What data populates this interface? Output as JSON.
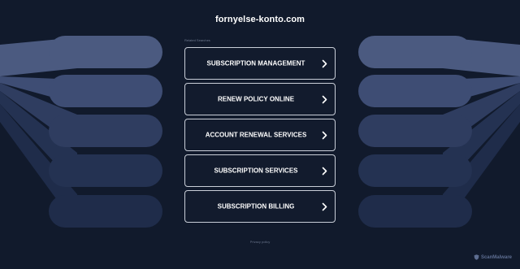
{
  "page": {
    "domain": "fornyelse-konto.com",
    "related_label": "Related Searches",
    "privacy_label": "Privacy policy"
  },
  "links": [
    {
      "label": "SUBSCRIPTION MANAGEMENT"
    },
    {
      "label": "RENEW POLICY ONLINE"
    },
    {
      "label": "ACCOUNT RENEWAL SERVICES"
    },
    {
      "label": "SUBSCRIPTION SERVICES"
    },
    {
      "label": "SUBSCRIPTION BILLING"
    }
  ],
  "badge": {
    "name": "ScanMalware",
    "icon": "shield-icon"
  },
  "colors": {
    "background": "#111a2c",
    "link_border": "#c9ced8",
    "text": "#ffffff",
    "band_light": "#4a5a80",
    "band_dark": "#1e2b4a"
  }
}
